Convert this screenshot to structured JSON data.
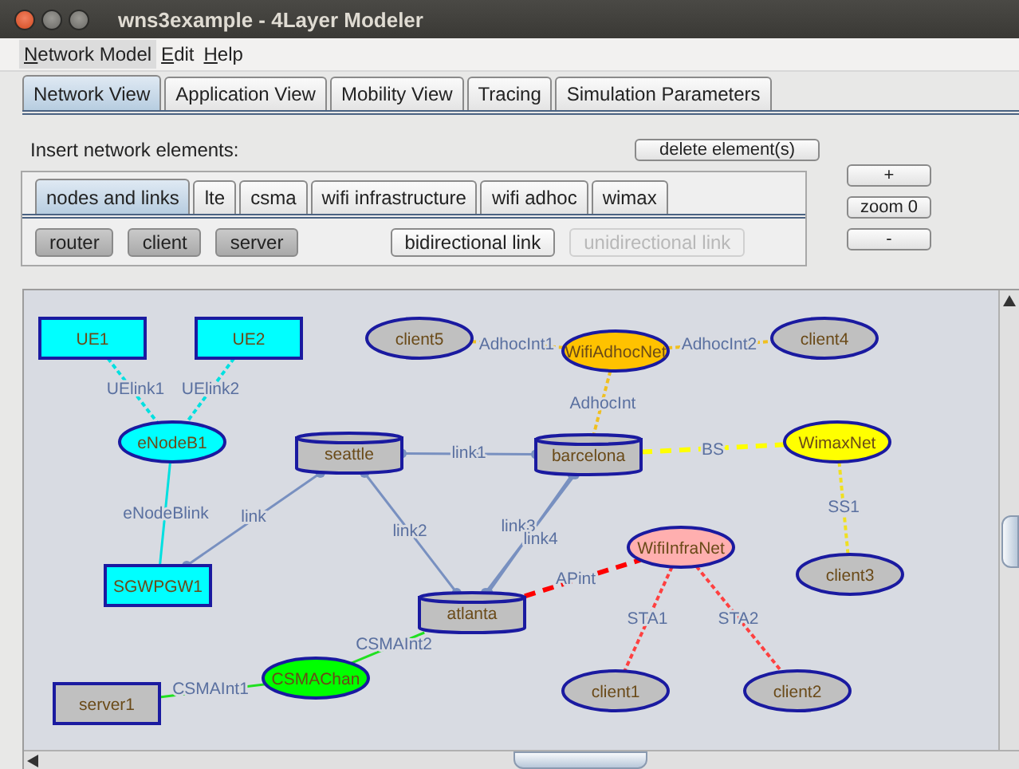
{
  "window": {
    "title": "wns3example - 4Layer Modeler"
  },
  "menu": [
    {
      "label": "Network Model",
      "selected": true
    },
    {
      "label": "Edit",
      "selected": false
    },
    {
      "label": "Help",
      "selected": false
    }
  ],
  "tabs": [
    {
      "label": "Network View",
      "selected": true
    },
    {
      "label": "Application View",
      "selected": false
    },
    {
      "label": "Mobility View",
      "selected": false
    },
    {
      "label": "Tracing",
      "selected": false
    },
    {
      "label": "Simulation Parameters",
      "selected": false
    }
  ],
  "insert_label": "Insert network elements:",
  "delete_button": "delete element(s)",
  "element_tabs": [
    {
      "label": "nodes and links",
      "selected": true
    },
    {
      "label": "lte",
      "selected": false
    },
    {
      "label": "csma",
      "selected": false
    },
    {
      "label": "wifi infrastructure",
      "selected": false
    },
    {
      "label": "wifi adhoc",
      "selected": false
    },
    {
      "label": "wimax",
      "selected": false
    }
  ],
  "element_buttons": [
    {
      "label": "router",
      "kind": "node",
      "disabled": false
    },
    {
      "label": "client",
      "kind": "node",
      "disabled": false
    },
    {
      "label": "server",
      "kind": "node",
      "disabled": false
    },
    {
      "label": "bidirectional link",
      "kind": "link",
      "disabled": false
    },
    {
      "label": "unidirectional link",
      "kind": "link",
      "disabled": true
    }
  ],
  "zoom_buttons": [
    "+",
    "zoom 0",
    "-"
  ],
  "nodes": [
    {
      "name": "UE1",
      "kind": "rect",
      "color": "#00ffff"
    },
    {
      "name": "UE2",
      "kind": "rect",
      "color": "#00ffff"
    },
    {
      "name": "client5",
      "kind": "ellipse",
      "color": "#c0c0c0"
    },
    {
      "name": "WifiAdhocNet",
      "kind": "ellipse",
      "color": "#ffc200"
    },
    {
      "name": "client4",
      "kind": "ellipse",
      "color": "#c0c0c0"
    },
    {
      "name": "eNodeB1",
      "kind": "ellipse",
      "color": "#00ffff"
    },
    {
      "name": "seattle",
      "kind": "cylinder",
      "color": "#c0c0c0"
    },
    {
      "name": "barcelona",
      "kind": "cylinder",
      "color": "#c0c0c0"
    },
    {
      "name": "WimaxNet",
      "kind": "ellipse",
      "color": "#ffff00"
    },
    {
      "name": "SGWPGW1",
      "kind": "rect",
      "color": "#00ffff"
    },
    {
      "name": "WifiInfraNet",
      "kind": "ellipse",
      "color": "#ffafaf"
    },
    {
      "name": "client3",
      "kind": "ellipse",
      "color": "#c0c0c0"
    },
    {
      "name": "atlanta",
      "kind": "cylinder",
      "color": "#c0c0c0"
    },
    {
      "name": "CSMAChan",
      "kind": "ellipse",
      "color": "#00ff00"
    },
    {
      "name": "server1",
      "kind": "rect",
      "color": "#c0c0c0"
    },
    {
      "name": "client1",
      "kind": "ellipse",
      "color": "#c0c0c0"
    },
    {
      "name": "client2",
      "kind": "ellipse",
      "color": "#c0c0c0"
    }
  ],
  "links": [
    {
      "label": "UElink1",
      "kind": "dotted",
      "color": "#00e0e0"
    },
    {
      "label": "UElink2",
      "kind": "dotted",
      "color": "#00e0e0"
    },
    {
      "label": "eNodeBlink",
      "kind": "solid",
      "color": "#00e0e0"
    },
    {
      "label": "link",
      "kind": "wired",
      "color": "#7890c0"
    },
    {
      "label": "link1",
      "kind": "wired",
      "color": "#7890c0"
    },
    {
      "label": "link2",
      "kind": "wired",
      "color": "#7890c0"
    },
    {
      "label": "link3",
      "kind": "wired",
      "color": "#7890c0"
    },
    {
      "label": "link4",
      "kind": "wired",
      "color": "#7890c0"
    },
    {
      "label": "AdhocInt1",
      "kind": "dotted",
      "color": "#f0c020"
    },
    {
      "label": "AdhocInt2",
      "kind": "dotted",
      "color": "#f0c020"
    },
    {
      "label": "AdhocInt",
      "kind": "dotted",
      "color": "#f0c020"
    },
    {
      "label": "BS",
      "kind": "dashed",
      "color": "#ffff00"
    },
    {
      "label": "SS1",
      "kind": "dotted",
      "color": "#f0e020"
    },
    {
      "label": "APint",
      "kind": "dashed",
      "color": "#ff0000"
    },
    {
      "label": "STA1",
      "kind": "dotted",
      "color": "#ff4040"
    },
    {
      "label": "STA2",
      "kind": "dotted",
      "color": "#ff4040"
    },
    {
      "label": "CSMAInt2",
      "kind": "solid",
      "color": "#20e020"
    },
    {
      "label": "CSMAInt1",
      "kind": "solid",
      "color": "#20e020"
    }
  ]
}
